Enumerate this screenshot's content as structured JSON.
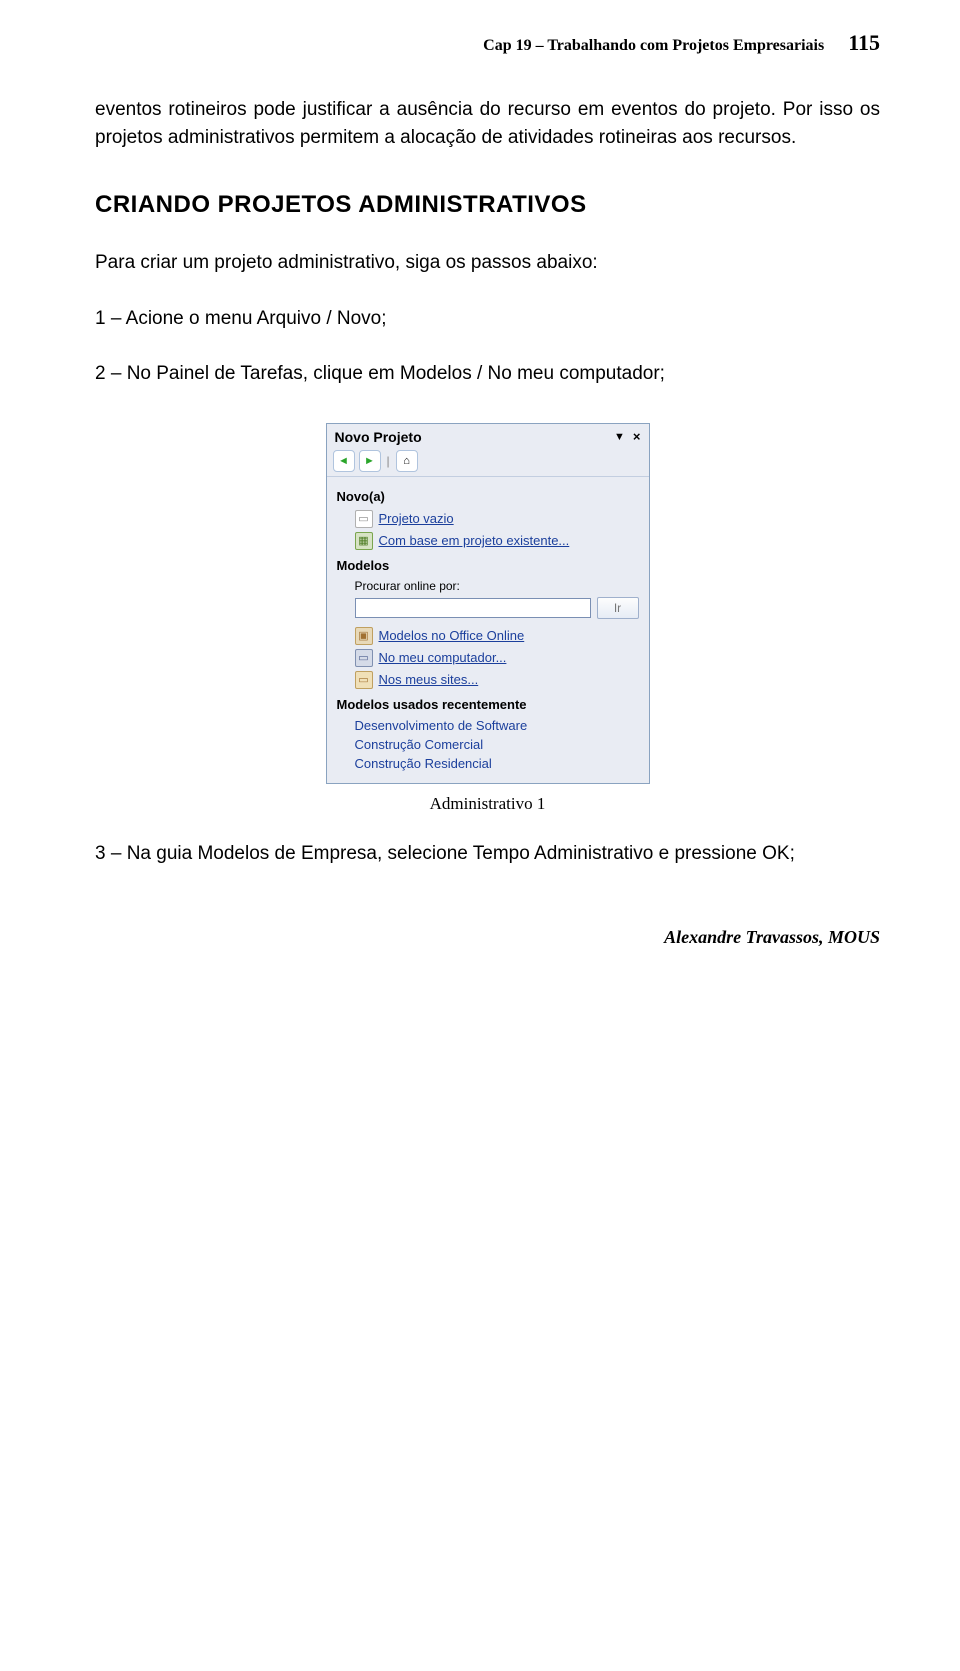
{
  "header": {
    "chapter": "Cap 19 – Trabalhando com Projetos Empresariais",
    "page_number": "115"
  },
  "paragraphs": {
    "p1": "eventos rotineiros pode justificar a ausência do recurso em eventos do projeto. Por isso os projetos administrativos permitem a alocação de atividades rotineiras aos recursos."
  },
  "section_heading": "CRIANDO PROJETOS ADMINISTRATIVOS",
  "intro": "Para criar um projeto administrativo, siga os passos abaixo:",
  "steps": {
    "s1": "1 – Acione o menu Arquivo / Novo;",
    "s2": "2 – No Painel de Tarefas, clique em Modelos / No meu computador;",
    "s3": "3 – Na guia Modelos de Empresa, selecione Tempo Administrativo e pressione OK;"
  },
  "panel": {
    "title": "Novo Projeto",
    "nav": {
      "back_tip": "Voltar",
      "fwd_tip": "Avançar",
      "home_tip": "Início"
    },
    "cat_new": "Novo(a)",
    "item_blank": "Projeto vazio",
    "item_existing": "Com base em projeto existente...",
    "cat_templates": "Modelos",
    "search_label": "Procurar online por:",
    "search_placeholder": "",
    "ir_label": "Ir",
    "item_office_online": "Modelos no Office Online",
    "item_my_computer": "No meu computador...",
    "item_my_sites": "Nos meus sites...",
    "cat_recent": "Modelos usados recentemente",
    "recent1": "Desenvolvimento de Software",
    "recent2": "Construção Comercial",
    "recent3": "Construção Residencial"
  },
  "caption": "Administrativo 1",
  "footer": "Alexandre Travassos, MOUS"
}
